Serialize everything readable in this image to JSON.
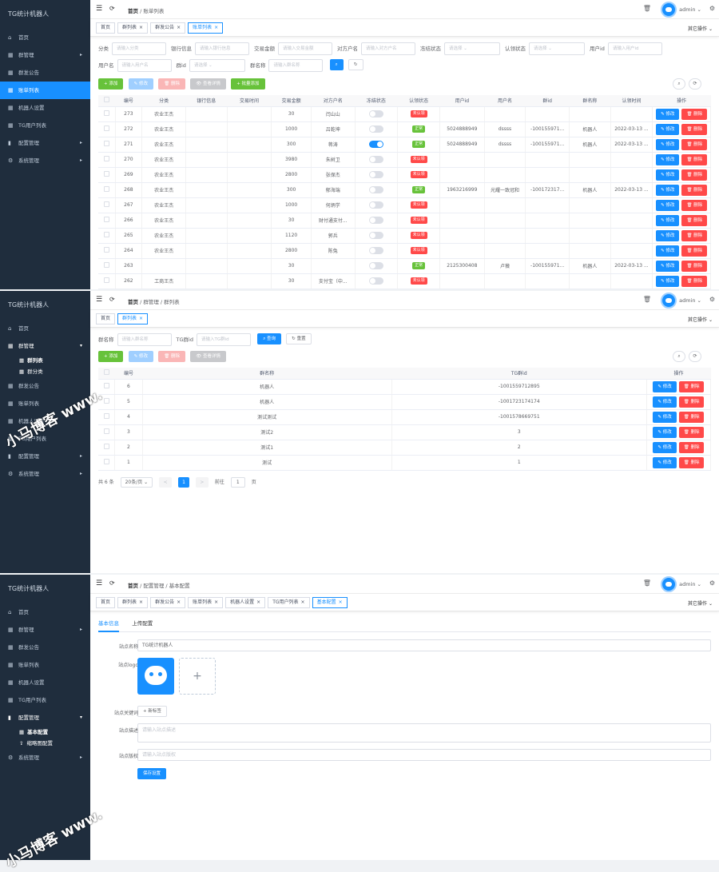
{
  "app_title": "TG统计机器人",
  "user": "admin",
  "other_actions": "其它操作",
  "bc_home": "首页",
  "p1": {
    "sidebar": [
      {
        "icon": "⌂",
        "label": "首页"
      },
      {
        "icon": "▦",
        "label": "群管理",
        "arrow": "▸"
      },
      {
        "icon": "▦",
        "label": "群发公告"
      },
      {
        "icon": "▦",
        "label": "账单列表",
        "active": true
      },
      {
        "icon": "▦",
        "label": "机器人设置"
      },
      {
        "icon": "▦",
        "label": "TG用户列表"
      },
      {
        "icon": "▮",
        "label": "配置管理",
        "arrow": "▸"
      },
      {
        "icon": "⚙",
        "label": "系统管理",
        "arrow": "▸"
      }
    ],
    "breadcrumb": [
      "账单列表"
    ],
    "tabs": [
      {
        "label": "首页"
      },
      {
        "label": "群列表",
        "close": "×"
      },
      {
        "label": "群发公告",
        "close": "×"
      },
      {
        "label": "账单列表",
        "close": "×",
        "active": true
      }
    ],
    "filters_row1": [
      {
        "label": "分类",
        "ph": "请输入分类"
      },
      {
        "label": "银行信息",
        "ph": "请输入银行信息"
      },
      {
        "label": "交易金额",
        "ph": "请输入交易金额"
      },
      {
        "label": "对方户名",
        "ph": "请输入对方户名"
      },
      {
        "label": "冻结状态",
        "ph": "请选择"
      },
      {
        "label": "认领状态",
        "ph": "请选择"
      },
      {
        "label": "用户id",
        "ph": "请输入用户id"
      }
    ],
    "filters_row2": [
      {
        "label": "用户名",
        "ph": "请输入用户名"
      },
      {
        "label": "群id",
        "ph": "请选择"
      },
      {
        "label": "群名称",
        "ph": "请输入群名称"
      }
    ],
    "search": "查询",
    "reset": "重置",
    "actions": [
      "添加",
      "修改",
      "删除",
      "查看详情",
      "批量添加"
    ],
    "columns": [
      "编号",
      "分类",
      "银行信息",
      "交易时间",
      "交易金额",
      "对方户名",
      "冻结状态",
      "认领状态",
      "用户id",
      "用户名",
      "群id",
      "群名称",
      "认领时间",
      "操作"
    ],
    "edit": "修改",
    "del": "删除",
    "rows": [
      {
        "id": "273",
        "cat": "农业王杰",
        "amt": "30",
        "name": "闫山山",
        "frz": false,
        "st": "未认领",
        "uid": "",
        "un": "",
        "gid": "",
        "gn": "",
        "tm": ""
      },
      {
        "id": "272",
        "cat": "农业王杰",
        "amt": "1000",
        "name": "吕乾坤",
        "frz": false,
        "st": "正常",
        "uid": "5024888949",
        "un": "dssss",
        "gid": "-100155971...",
        "gn": "机器人",
        "tm": "2022-03-13 ..."
      },
      {
        "id": "271",
        "cat": "农业王杰",
        "amt": "300",
        "name": "蒋涛",
        "frz": true,
        "st": "正常",
        "uid": "5024888949",
        "un": "dssss",
        "gid": "-100155971...",
        "gn": "机器人",
        "tm": "2022-03-13 ..."
      },
      {
        "id": "270",
        "cat": "农业王杰",
        "amt": "3980",
        "name": "朱树卫",
        "frz": false,
        "st": "未认领",
        "uid": "",
        "un": "",
        "gid": "",
        "gn": "",
        "tm": ""
      },
      {
        "id": "269",
        "cat": "农业王杰",
        "amt": "2800",
        "name": "张保杰",
        "frz": false,
        "st": "未认领",
        "uid": "",
        "un": "",
        "gid": "",
        "gn": "",
        "tm": ""
      },
      {
        "id": "268",
        "cat": "农业王杰",
        "amt": "300",
        "name": "郁海端",
        "frz": false,
        "st": "正常",
        "uid": "1963216999",
        "un": "光耀一致冠和",
        "gid": "-100172317...",
        "gn": "机器人",
        "tm": "2022-03-13 ..."
      },
      {
        "id": "267",
        "cat": "农业王杰",
        "amt": "1000",
        "name": "何炳学",
        "frz": false,
        "st": "未认领",
        "uid": "",
        "un": "",
        "gid": "",
        "gn": "",
        "tm": ""
      },
      {
        "id": "266",
        "cat": "农业王杰",
        "amt": "30",
        "name": "财付通支付...",
        "frz": false,
        "st": "未认领",
        "uid": "",
        "un": "",
        "gid": "",
        "gn": "",
        "tm": ""
      },
      {
        "id": "265",
        "cat": "农业王杰",
        "amt": "1120",
        "name": "郭兵",
        "frz": false,
        "st": "未认领",
        "uid": "",
        "un": "",
        "gid": "",
        "gn": "",
        "tm": ""
      },
      {
        "id": "264",
        "cat": "农业王杰",
        "amt": "2800",
        "name": "陈兔",
        "frz": false,
        "st": "未认领",
        "uid": "",
        "un": "",
        "gid": "",
        "gn": "",
        "tm": ""
      },
      {
        "id": "263",
        "cat": "",
        "amt": "30",
        "name": "",
        "frz": false,
        "st": "正常",
        "uid": "2125300408",
        "un": "卢薇",
        "gid": "-100155971...",
        "gn": "机器人",
        "tm": "2022-03-13 ..."
      },
      {
        "id": "262",
        "cat": "工商王杰",
        "amt": "30",
        "name": "支付宝（中...",
        "frz": false,
        "st": "未认领",
        "uid": "",
        "un": "",
        "gid": "",
        "gn": "",
        "tm": ""
      }
    ]
  },
  "p2": {
    "sidebar": [
      {
        "icon": "⌂",
        "label": "首页"
      },
      {
        "icon": "▦",
        "label": "群管理",
        "arrow": "▾",
        "active": true
      },
      {
        "sub": true,
        "label": "群列表",
        "sel": true
      },
      {
        "sub": true,
        "label": "群分类"
      },
      {
        "icon": "▦",
        "label": "群发公告"
      },
      {
        "icon": "▦",
        "label": "账单列表"
      },
      {
        "icon": "▦",
        "label": "机器人设置"
      },
      {
        "icon": "▦",
        "label": "TG用户列表"
      },
      {
        "icon": "▮",
        "label": "配置管理",
        "arrow": "▸"
      },
      {
        "icon": "⚙",
        "label": "系统管理",
        "arrow": "▸"
      }
    ],
    "breadcrumb": [
      "群管理",
      "群列表"
    ],
    "tabs": [
      {
        "label": "首页"
      },
      {
        "label": "群列表",
        "close": "×",
        "active": true
      }
    ],
    "filters": [
      {
        "label": "群名称",
        "ph": "请输入群名称"
      },
      {
        "label": "TG群id",
        "ph": "请输入TG群id"
      }
    ],
    "actions": [
      "添加",
      "修改",
      "删除",
      "查看详情"
    ],
    "columns": [
      "编号",
      "群名称",
      "TG群id",
      "操作"
    ],
    "rows": [
      {
        "id": "6",
        "name": "机器人",
        "tg": "-1001559712895"
      },
      {
        "id": "5",
        "name": "机器人",
        "tg": "-1001723174174"
      },
      {
        "id": "4",
        "name": "测试测试",
        "tg": "-1001578669751"
      },
      {
        "id": "3",
        "name": "测试2",
        "tg": "3"
      },
      {
        "id": "2",
        "name": "测试1",
        "tg": "2"
      },
      {
        "id": "1",
        "name": "测试",
        "tg": "1"
      }
    ],
    "pager": {
      "total": "共 6 条",
      "size": "20条/页 ⌄",
      "prev": "<",
      "page": "1",
      "next": ">",
      "goto": "前往",
      "goto_val": "1",
      "unit": "页"
    }
  },
  "p3": {
    "sidebar": [
      {
        "icon": "⌂",
        "label": "首页"
      },
      {
        "icon": "▦",
        "label": "群管理",
        "arrow": "▸"
      },
      {
        "icon": "▦",
        "label": "群发公告"
      },
      {
        "icon": "▦",
        "label": "账单列表"
      },
      {
        "icon": "▦",
        "label": "机器人设置"
      },
      {
        "icon": "▦",
        "label": "TG用户列表"
      },
      {
        "icon": "▮",
        "label": "配置管理",
        "arrow": "▾",
        "active": true
      },
      {
        "sub": true,
        "label": "基本配置",
        "sel": true
      },
      {
        "sub": true,
        "label": "缩略图配置",
        "icon": "⇪"
      },
      {
        "icon": "⚙",
        "label": "系统管理",
        "arrow": "▸"
      }
    ],
    "breadcrumb": [
      "配置管理",
      "基本配置"
    ],
    "tabs": [
      {
        "label": "首页"
      },
      {
        "label": "群列表",
        "close": "×"
      },
      {
        "label": "群发公告",
        "close": "×"
      },
      {
        "label": "账单列表",
        "close": "×"
      },
      {
        "label": "机器人设置",
        "close": "×"
      },
      {
        "label": "TG用户列表",
        "close": "×"
      },
      {
        "label": "基本配置",
        "close": "×",
        "active": true
      }
    ],
    "cfg_tabs": [
      "基本信息",
      "上传配置"
    ],
    "site_name_label": "站点名称",
    "site_name": "TG统计机器人",
    "logo_label": "站点logo",
    "logo_plus": "+",
    "kw_label": "站点关键词",
    "kw_btn": "+ 新标签",
    "desc_label": "站点描述",
    "desc_ph": "请输入站点描述",
    "copy_label": "站点版权",
    "copy_ph": "请输入站点版权",
    "save": "保存设置"
  },
  "watermark": "小马博客 www."
}
